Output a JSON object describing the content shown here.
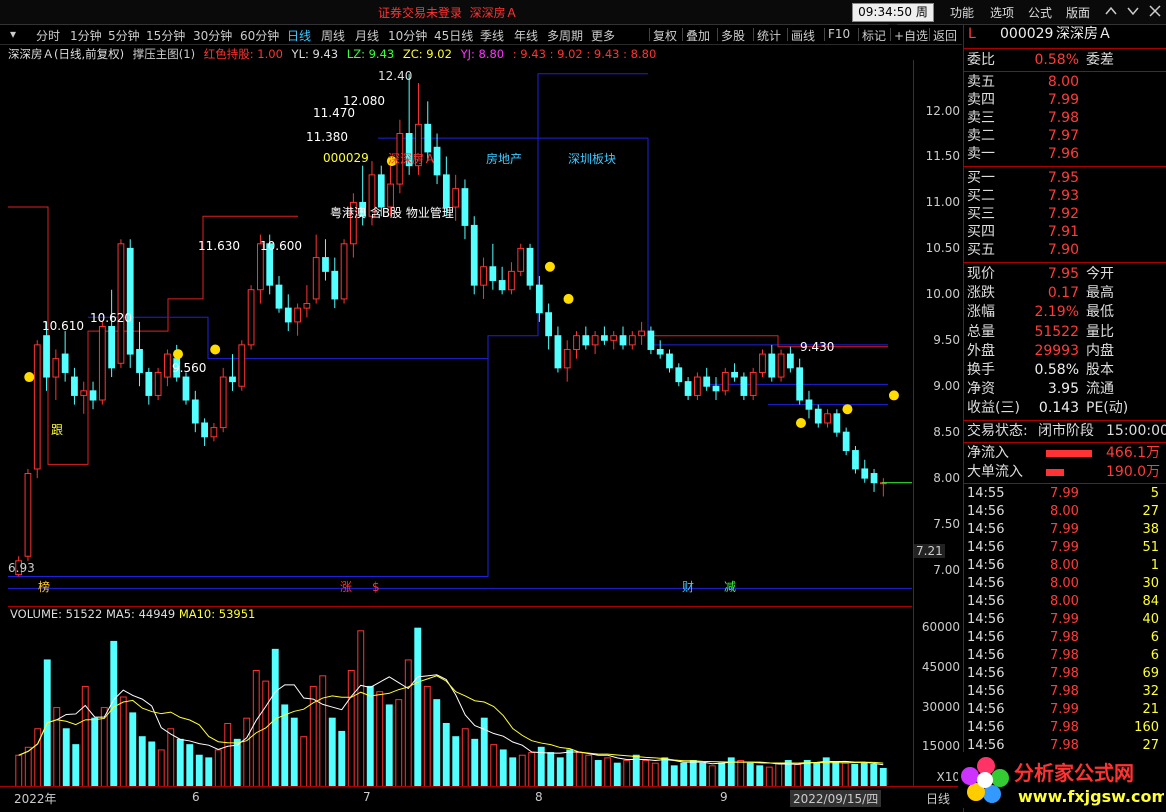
{
  "topbar": {
    "brand_status": "证券交易未登录",
    "brand_stock": "深深房Ａ",
    "clock": "09:34:50 周二",
    "menu": [
      "功能",
      "选项",
      "公式",
      "版面"
    ]
  },
  "period_toolbar": {
    "items": [
      "分时",
      "1分钟",
      "5分钟",
      "15分钟",
      "30分钟",
      "60分钟",
      "日线",
      "周线",
      "月线",
      "10分钟",
      "45日线",
      "季线",
      "年线",
      "多周期",
      "更多"
    ],
    "selected": "日线",
    "right_items": [
      "复权",
      "叠加",
      "多股",
      "统计",
      "画线",
      "F10",
      "标记",
      "+自选",
      "返回"
    ]
  },
  "legend": {
    "title": "深深房Ａ(日线,前复权)",
    "indicator": "撑压主图(1)",
    "hongse": "红色持股: 1.00",
    "yl": "YL: 9.43",
    "lz": "LZ: 9.43",
    "zc": "ZC: 9.02",
    "yj": "YJ: 8.80",
    "extra": ": 9.43 : 9.02 : 9.43 : 8.80"
  },
  "colors": {
    "up": "#ff3333",
    "down": "#54ffff",
    "vol_up": "#ff3333",
    "vol_down": "#54ffff",
    "ma5": "#ffffff",
    "ma10": "#ffff33"
  },
  "chart_data": {
    "type": "candlestick",
    "price_axis": {
      "ylim": [
        6.75,
        12.55
      ],
      "ticks": [
        "12.00",
        "11.50",
        "11.00",
        "10.50",
        "10.00",
        "9.50",
        "9.00",
        "8.50",
        "8.00",
        "7.50",
        "7.00"
      ],
      "current_mark": "7.21"
    },
    "x_labels": [
      "2022年",
      "6",
      "7",
      "8",
      "9",
      "2022/09/15/四"
    ],
    "annotations": [
      "12.40",
      "12.080",
      "11.470",
      "11.380",
      "000029",
      "深深房Ａ",
      "房地产",
      "深圳板块",
      "粤港澳 含B股 物业管理",
      "11.630",
      "10.600",
      "10.610",
      "10.620",
      "9.560",
      "9.430",
      "6.93",
      "跟"
    ],
    "bottom_markers": [
      "榜",
      "涨",
      "$",
      "财",
      "减"
    ],
    "candles": [
      {
        "o": 6.95,
        "h": 7.15,
        "l": 6.93,
        "c": 7.1
      },
      {
        "o": 7.15,
        "h": 8.1,
        "l": 7.1,
        "c": 8.05
      },
      {
        "o": 8.1,
        "h": 9.5,
        "l": 8.0,
        "c": 9.45
      },
      {
        "o": 9.55,
        "h": 9.7,
        "l": 8.95,
        "c": 9.1
      },
      {
        "o": 9.1,
        "h": 9.4,
        "l": 8.85,
        "c": 9.3
      },
      {
        "o": 9.35,
        "h": 9.6,
        "l": 9.05,
        "c": 9.15
      },
      {
        "o": 9.1,
        "h": 9.2,
        "l": 8.8,
        "c": 8.9
      },
      {
        "o": 8.9,
        "h": 9.05,
        "l": 8.7,
        "c": 8.95
      },
      {
        "o": 8.95,
        "h": 9.05,
        "l": 8.75,
        "c": 8.85
      },
      {
        "o": 8.85,
        "h": 9.7,
        "l": 8.8,
        "c": 9.65
      },
      {
        "o": 9.65,
        "h": 10.05,
        "l": 9.1,
        "c": 9.2
      },
      {
        "o": 9.25,
        "h": 10.6,
        "l": 9.2,
        "c": 10.55
      },
      {
        "o": 10.5,
        "h": 10.6,
        "l": 9.2,
        "c": 9.35
      },
      {
        "o": 9.4,
        "h": 9.7,
        "l": 9.0,
        "c": 9.15
      },
      {
        "o": 9.15,
        "h": 9.2,
        "l": 8.8,
        "c": 8.9
      },
      {
        "o": 8.9,
        "h": 9.2,
        "l": 8.85,
        "c": 9.15
      },
      {
        "o": 9.1,
        "h": 9.4,
        "l": 9.0,
        "c": 9.35
      },
      {
        "o": 9.3,
        "h": 9.45,
        "l": 9.05,
        "c": 9.1
      },
      {
        "o": 9.1,
        "h": 9.15,
        "l": 8.8,
        "c": 8.85
      },
      {
        "o": 8.85,
        "h": 8.95,
        "l": 8.5,
        "c": 8.6
      },
      {
        "o": 8.6,
        "h": 8.65,
        "l": 8.35,
        "c": 8.45
      },
      {
        "o": 8.45,
        "h": 8.6,
        "l": 8.4,
        "c": 8.55
      },
      {
        "o": 8.55,
        "h": 9.2,
        "l": 8.5,
        "c": 9.1
      },
      {
        "o": 9.1,
        "h": 9.35,
        "l": 8.95,
        "c": 9.05
      },
      {
        "o": 9.0,
        "h": 9.5,
        "l": 8.95,
        "c": 9.45
      },
      {
        "o": 9.45,
        "h": 10.1,
        "l": 9.4,
        "c": 10.05
      },
      {
        "o": 10.05,
        "h": 10.65,
        "l": 9.9,
        "c": 10.55
      },
      {
        "o": 10.55,
        "h": 10.65,
        "l": 10.0,
        "c": 10.1
      },
      {
        "o": 10.1,
        "h": 10.2,
        "l": 9.8,
        "c": 9.85
      },
      {
        "o": 9.85,
        "h": 10.0,
        "l": 9.6,
        "c": 9.7
      },
      {
        "o": 9.7,
        "h": 9.9,
        "l": 9.55,
        "c": 9.85
      },
      {
        "o": 9.85,
        "h": 10.1,
        "l": 9.75,
        "c": 9.9
      },
      {
        "o": 9.95,
        "h": 10.65,
        "l": 9.9,
        "c": 10.4
      },
      {
        "o": 10.4,
        "h": 10.6,
        "l": 10.15,
        "c": 10.25
      },
      {
        "o": 10.25,
        "h": 10.4,
        "l": 9.85,
        "c": 9.95
      },
      {
        "o": 9.95,
        "h": 10.6,
        "l": 9.9,
        "c": 10.55
      },
      {
        "o": 10.55,
        "h": 11.1,
        "l": 10.4,
        "c": 11.0
      },
      {
        "o": 11.0,
        "h": 11.4,
        "l": 10.75,
        "c": 10.85
      },
      {
        "o": 10.85,
        "h": 11.45,
        "l": 10.75,
        "c": 11.3
      },
      {
        "o": 11.3,
        "h": 11.4,
        "l": 10.85,
        "c": 10.95
      },
      {
        "o": 10.95,
        "h": 11.4,
        "l": 10.85,
        "c": 11.2
      },
      {
        "o": 11.2,
        "h": 11.9,
        "l": 11.1,
        "c": 11.75
      },
      {
        "o": 11.75,
        "h": 12.4,
        "l": 11.3,
        "c": 11.4
      },
      {
        "o": 11.4,
        "h": 12.3,
        "l": 11.3,
        "c": 11.85
      },
      {
        "o": 11.85,
        "h": 12.1,
        "l": 11.45,
        "c": 11.55
      },
      {
        "o": 11.6,
        "h": 11.75,
        "l": 11.2,
        "c": 11.3
      },
      {
        "o": 11.3,
        "h": 11.5,
        "l": 10.85,
        "c": 10.95
      },
      {
        "o": 10.95,
        "h": 11.3,
        "l": 10.8,
        "c": 11.15
      },
      {
        "o": 11.15,
        "h": 11.25,
        "l": 10.6,
        "c": 10.75
      },
      {
        "o": 10.75,
        "h": 10.85,
        "l": 10.0,
        "c": 10.1
      },
      {
        "o": 10.1,
        "h": 10.4,
        "l": 9.95,
        "c": 10.3
      },
      {
        "o": 10.3,
        "h": 10.55,
        "l": 10.05,
        "c": 10.15
      },
      {
        "o": 10.15,
        "h": 10.3,
        "l": 10.0,
        "c": 10.05
      },
      {
        "o": 10.05,
        "h": 10.35,
        "l": 10.0,
        "c": 10.25
      },
      {
        "o": 10.25,
        "h": 10.55,
        "l": 10.2,
        "c": 10.5
      },
      {
        "o": 10.5,
        "h": 10.55,
        "l": 10.05,
        "c": 10.1
      },
      {
        "o": 10.1,
        "h": 10.2,
        "l": 9.7,
        "c": 9.8
      },
      {
        "o": 9.8,
        "h": 9.9,
        "l": 9.4,
        "c": 9.55
      },
      {
        "o": 9.55,
        "h": 9.65,
        "l": 9.15,
        "c": 9.2
      },
      {
        "o": 9.2,
        "h": 9.5,
        "l": 9.05,
        "c": 9.4
      },
      {
        "o": 9.4,
        "h": 9.6,
        "l": 9.3,
        "c": 9.55
      },
      {
        "o": 9.55,
        "h": 9.65,
        "l": 9.4,
        "c": 9.45
      },
      {
        "o": 9.45,
        "h": 9.6,
        "l": 9.35,
        "c": 9.55
      },
      {
        "o": 9.55,
        "h": 9.65,
        "l": 9.45,
        "c": 9.5
      },
      {
        "o": 9.5,
        "h": 9.6,
        "l": 9.4,
        "c": 9.55
      },
      {
        "o": 9.55,
        "h": 9.65,
        "l": 9.4,
        "c": 9.45
      },
      {
        "o": 9.45,
        "h": 9.6,
        "l": 9.4,
        "c": 9.55
      },
      {
        "o": 9.55,
        "h": 9.7,
        "l": 9.45,
        "c": 9.6
      },
      {
        "o": 9.6,
        "h": 9.65,
        "l": 9.35,
        "c": 9.4
      },
      {
        "o": 9.4,
        "h": 9.5,
        "l": 9.3,
        "c": 9.35
      },
      {
        "o": 9.35,
        "h": 9.4,
        "l": 9.15,
        "c": 9.2
      },
      {
        "o": 9.2,
        "h": 9.25,
        "l": 9.0,
        "c": 9.05
      },
      {
        "o": 9.05,
        "h": 9.1,
        "l": 8.85,
        "c": 8.9
      },
      {
        "o": 8.9,
        "h": 9.15,
        "l": 8.85,
        "c": 9.1
      },
      {
        "o": 9.1,
        "h": 9.2,
        "l": 8.95,
        "c": 9.0
      },
      {
        "o": 9.0,
        "h": 9.1,
        "l": 8.85,
        "c": 8.95
      },
      {
        "o": 8.95,
        "h": 9.2,
        "l": 8.9,
        "c": 9.15
      },
      {
        "o": 9.15,
        "h": 9.25,
        "l": 9.05,
        "c": 9.1
      },
      {
        "o": 9.1,
        "h": 9.15,
        "l": 8.85,
        "c": 8.9
      },
      {
        "o": 8.9,
        "h": 9.2,
        "l": 8.85,
        "c": 9.15
      },
      {
        "o": 9.15,
        "h": 9.4,
        "l": 9.1,
        "c": 9.35
      },
      {
        "o": 9.35,
        "h": 9.45,
        "l": 9.05,
        "c": 9.1
      },
      {
        "o": 9.1,
        "h": 9.4,
        "l": 9.05,
        "c": 9.35
      },
      {
        "o": 9.35,
        "h": 9.43,
        "l": 9.15,
        "c": 9.2
      },
      {
        "o": 9.2,
        "h": 9.3,
        "l": 8.8,
        "c": 8.85
      },
      {
        "o": 8.85,
        "h": 8.95,
        "l": 8.65,
        "c": 8.75
      },
      {
        "o": 8.75,
        "h": 8.8,
        "l": 8.55,
        "c": 8.6
      },
      {
        "o": 8.6,
        "h": 8.75,
        "l": 8.55,
        "c": 8.7
      },
      {
        "o": 8.7,
        "h": 8.75,
        "l": 8.45,
        "c": 8.5
      },
      {
        "o": 8.5,
        "h": 8.55,
        "l": 8.25,
        "c": 8.3
      },
      {
        "o": 8.3,
        "h": 8.35,
        "l": 8.05,
        "c": 8.1
      },
      {
        "o": 8.1,
        "h": 8.2,
        "l": 7.95,
        "c": 8.0
      },
      {
        "o": 8.05,
        "h": 8.1,
        "l": 7.85,
        "c": 7.95
      },
      {
        "o": 7.95,
        "h": 8.0,
        "l": 7.8,
        "c": 7.95
      }
    ]
  },
  "volume": {
    "label": "VOLUME: 51522",
    "ma5": "MA5: 44949",
    "ma10": "MA10: 53951",
    "ticks": [
      "60000",
      "45000",
      "30000",
      "15000"
    ],
    "unit": "X10",
    "ylim": [
      0,
      68000
    ],
    "values": [
      12000,
      15000,
      22000,
      48000,
      30000,
      22000,
      16000,
      38000,
      26000,
      30000,
      55000,
      34000,
      28000,
      19000,
      17000,
      14000,
      22000,
      18000,
      16000,
      12000,
      11000,
      14000,
      24000,
      18000,
      26000,
      44000,
      40000,
      52000,
      31000,
      26000,
      19000,
      38000,
      42000,
      26000,
      21000,
      44000,
      59000,
      38000,
      36000,
      31000,
      33000,
      48000,
      60000,
      38000,
      33000,
      24000,
      19000,
      22000,
      18000,
      26000,
      16000,
      14000,
      11000,
      12000,
      13000,
      15000,
      13000,
      11000,
      14000,
      13000,
      12000,
      10000,
      11000,
      9000,
      10000,
      12000,
      10000,
      9000,
      11000,
      8000,
      9000,
      10000,
      9000,
      8000,
      9000,
      11000,
      10000,
      9000,
      8000,
      7500,
      9000,
      10000,
      8500,
      10000,
      9000,
      11000,
      9500,
      9000,
      8500,
      9000,
      8500,
      7000
    ]
  },
  "rpanel": {
    "header_code": "000029",
    "header_name": "深深房Ａ",
    "header_flag": "L",
    "weibi_label": "委比",
    "weibi_value": "0.58%",
    "weicha_label": "委差",
    "asks": [
      {
        "label": "卖五",
        "price": "8.00"
      },
      {
        "label": "卖四",
        "price": "7.99"
      },
      {
        "label": "卖三",
        "price": "7.98"
      },
      {
        "label": "卖二",
        "price": "7.97"
      },
      {
        "label": "卖一",
        "price": "7.96"
      }
    ],
    "bids": [
      {
        "label": "买一",
        "price": "7.95"
      },
      {
        "label": "买二",
        "price": "7.93"
      },
      {
        "label": "买三",
        "price": "7.92"
      },
      {
        "label": "买四",
        "price": "7.91"
      },
      {
        "label": "买五",
        "price": "7.90"
      }
    ],
    "stats": [
      {
        "l": "现价",
        "v": "7.95",
        "r": "今开"
      },
      {
        "l": "涨跌",
        "v": "0.17",
        "r": "最高"
      },
      {
        "l": "涨幅",
        "v": "2.19%",
        "r": "最低"
      },
      {
        "l": "总量",
        "v": "51522",
        "r": "量比"
      },
      {
        "l": "外盘",
        "v": "29993",
        "r": "内盘"
      },
      {
        "l": "换手",
        "v": "0.58%",
        "r": "股本"
      },
      {
        "l": "净资",
        "v": "3.95",
        "r": "流通"
      },
      {
        "l": "收益(三)",
        "v": "0.143",
        "r": "PE(动)"
      }
    ],
    "trade_state_label": "交易状态:",
    "trade_state_value": "闭市阶段",
    "trade_state_time": "15:00:00",
    "netflow_label": "净流入",
    "netflow_value": "466.1万",
    "bigflow_label": "大单流入",
    "bigflow_value": "190.0万",
    "ticks": [
      {
        "t": "14:55",
        "p": "7.99",
        "v": "5"
      },
      {
        "t": "14:56",
        "p": "8.00",
        "v": "27"
      },
      {
        "t": "14:56",
        "p": "7.99",
        "v": "38"
      },
      {
        "t": "14:56",
        "p": "7.99",
        "v": "51"
      },
      {
        "t": "14:56",
        "p": "8.00",
        "v": "1"
      },
      {
        "t": "14:56",
        "p": "8.00",
        "v": "30"
      },
      {
        "t": "14:56",
        "p": "8.00",
        "v": "84"
      },
      {
        "t": "14:56",
        "p": "7.99",
        "v": "40"
      },
      {
        "t": "14:56",
        "p": "7.98",
        "v": "6"
      },
      {
        "t": "14:56",
        "p": "7.98",
        "v": "6"
      },
      {
        "t": "14:56",
        "p": "7.98",
        "v": "69"
      },
      {
        "t": "14:56",
        "p": "7.98",
        "v": "32"
      },
      {
        "t": "14:56",
        "p": "7.99",
        "v": "21"
      },
      {
        "t": "14:56",
        "p": "7.98",
        "v": "160"
      },
      {
        "t": "14:56",
        "p": "7.98",
        "v": "27"
      }
    ]
  },
  "watermark": {
    "title": "分析家公式网",
    "url": "www.fxjgsw.com"
  },
  "bottom_right_label": "日线"
}
